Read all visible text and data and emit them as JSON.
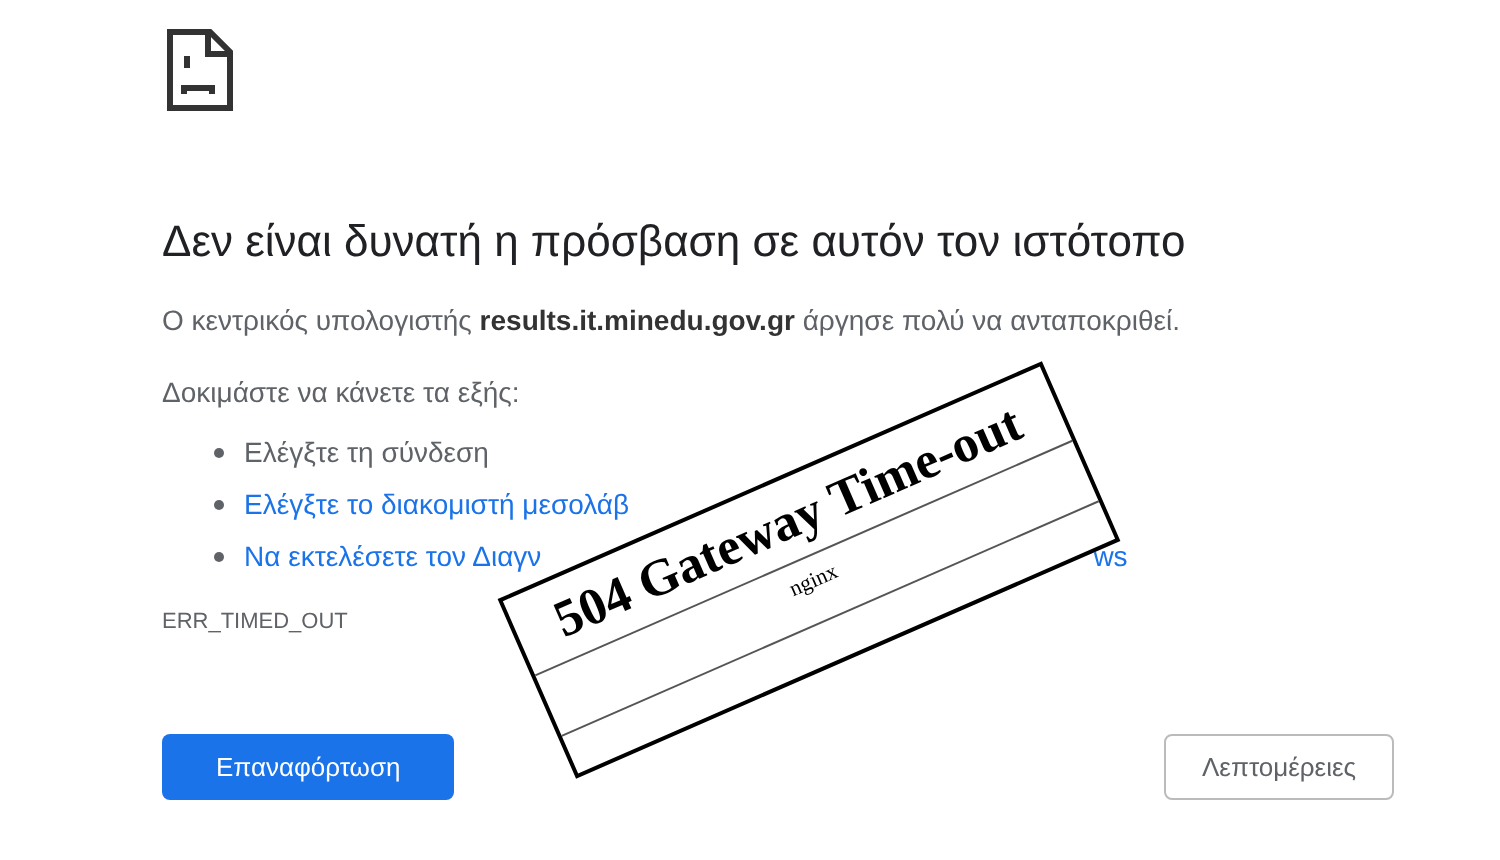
{
  "heading": "Δεν είναι δυνατή η πρόσβαση σε αυτόν τον ιστότοπο",
  "message": "Ο κεντρικός υπολογιστής **results.it.minedu.gov.gr** άργησε πολύ να ανταποκριθεί.",
  "suggestions_title": "Δοκιμάστε να κάνετε τα εξής:",
  "suggestions": [
    {
      "kind": "text",
      "parts": [
        "Ελέγξτε τη σύνδεση"
      ]
    },
    {
      "kind": "link",
      "parts": [
        "Ελέγξτε το διακομιστή μεσολάβ"
      ]
    },
    {
      "kind": "link",
      "parts": [
        "Να εκτελέσετε τον Διαγν",
        "ws"
      ]
    }
  ],
  "error_code": "ERR_TIMED_OUT",
  "reload_button": "Επαναφόρτωση",
  "details_button": "Λεπτομέρειες",
  "overlay": {
    "title": "504 Gateway Time-out",
    "server": "nginx"
  }
}
